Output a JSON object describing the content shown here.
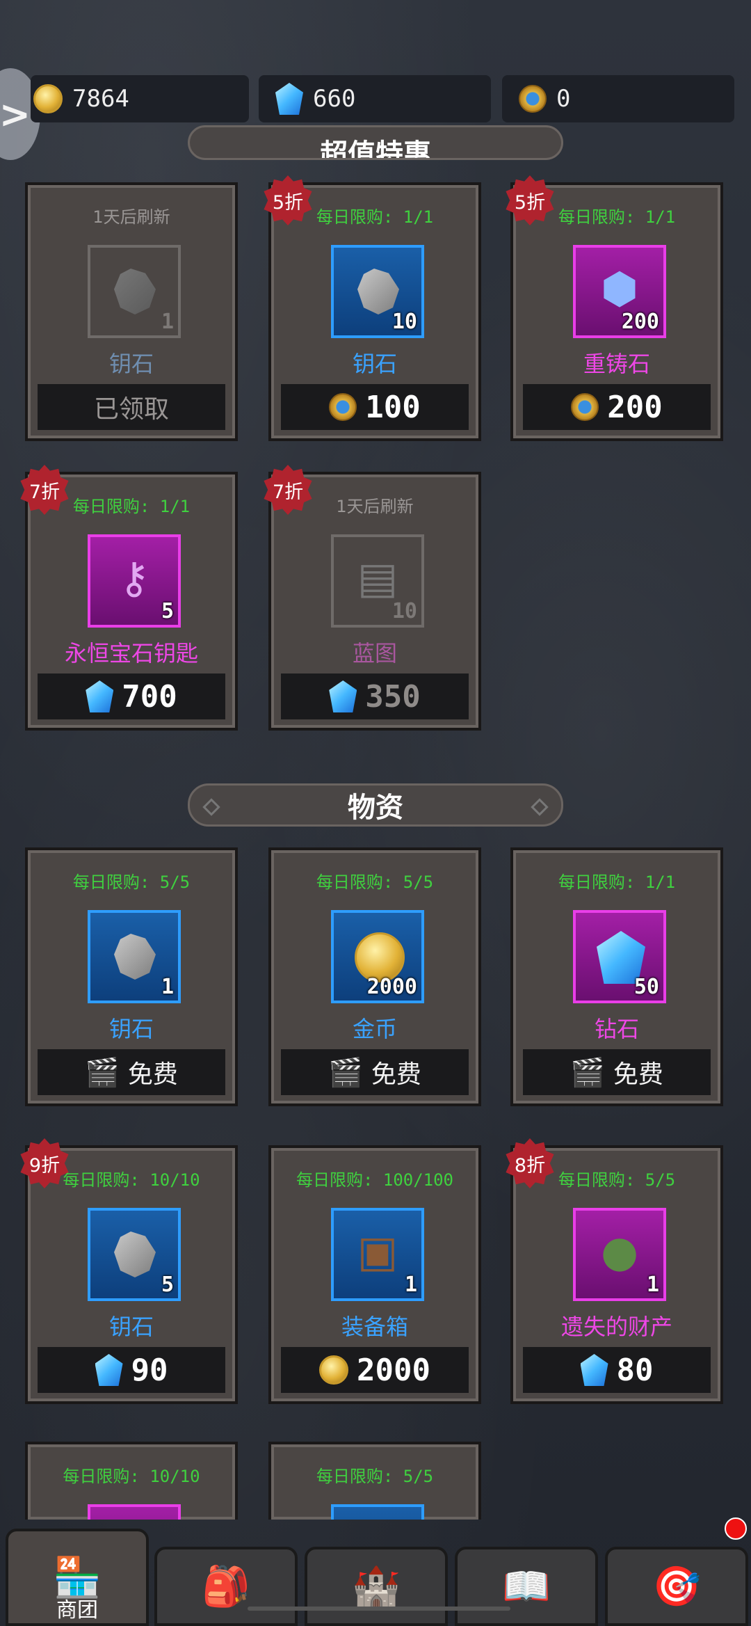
{
  "currencies": {
    "gold": "7864",
    "diamond": "660",
    "token": "0"
  },
  "sections": {
    "deals_title": "超值特惠",
    "supplies_title": "物资"
  },
  "deals": [
    {
      "badge": "",
      "limit": "1天后刷新",
      "qty": "1",
      "name": "钥石",
      "price": "",
      "price_text": "已领取",
      "price_icon": "none",
      "style": "dim"
    },
    {
      "badge": "5折",
      "limit": "每日限购: 1/1",
      "qty": "10",
      "name": "钥石",
      "price": "100",
      "price_text": "",
      "price_icon": "token",
      "style": "blue"
    },
    {
      "badge": "5折",
      "limit": "每日限购: 1/1",
      "qty": "200",
      "name": "重铸石",
      "price": "200",
      "price_text": "",
      "price_icon": "token",
      "style": "purple"
    },
    {
      "badge": "7折",
      "limit": "每日限购: 1/1",
      "qty": "5",
      "name": "永恒宝石钥匙",
      "price": "700",
      "price_text": "",
      "price_icon": "diamond",
      "style": "purple"
    },
    {
      "badge": "7折",
      "limit": "1天后刷新",
      "qty": "10",
      "name": "蓝图",
      "price": "350",
      "price_text": "",
      "price_icon": "diamond",
      "style": "dim"
    }
  ],
  "supplies": [
    {
      "badge": "",
      "limit": "每日限购: 5/5",
      "qty": "1",
      "name": "钥石",
      "price": "",
      "price_text": "免费",
      "price_icon": "clapper",
      "style": "blue"
    },
    {
      "badge": "",
      "limit": "每日限购: 5/5",
      "qty": "2000",
      "name": "金币",
      "price": "",
      "price_text": "免费",
      "price_icon": "clapper",
      "style": "blue"
    },
    {
      "badge": "",
      "limit": "每日限购: 1/1",
      "qty": "50",
      "name": "钻石",
      "price": "",
      "price_text": "免费",
      "price_icon": "clapper",
      "style": "purple"
    },
    {
      "badge": "9折",
      "limit": "每日限购: 10/10",
      "qty": "5",
      "name": "钥石",
      "price": "90",
      "price_text": "",
      "price_icon": "diamond",
      "style": "blue"
    },
    {
      "badge": "",
      "limit": "每日限购: 100/100",
      "qty": "1",
      "name": "装备箱",
      "price": "2000",
      "price_text": "",
      "price_icon": "gold",
      "style": "blue"
    },
    {
      "badge": "8折",
      "limit": "每日限购: 5/5",
      "qty": "1",
      "name": "遗失的财产",
      "price": "80",
      "price_text": "",
      "price_icon": "diamond",
      "style": "purple"
    },
    {
      "badge": "",
      "limit": "每日限购: 10/10",
      "qty": "",
      "name": "",
      "price": "",
      "price_text": "",
      "price_icon": "none",
      "style": "purple"
    },
    {
      "badge": "",
      "limit": "每日限购: 5/5",
      "qty": "",
      "name": "",
      "price": "",
      "price_text": "",
      "price_icon": "none",
      "style": "blue"
    }
  ],
  "nav": {
    "tabs": [
      {
        "label": "商团",
        "icon": "shop-icon"
      },
      {
        "label": "",
        "icon": "backpack-icon"
      },
      {
        "label": "",
        "icon": "castle-icon"
      },
      {
        "label": "",
        "icon": "book-icon"
      },
      {
        "label": "",
        "icon": "target-icon"
      }
    ]
  },
  "colors": {
    "limit_green": "#3fd13f",
    "blue_name": "#3aa2ff",
    "purple_name": "#ee47e6",
    "badge_red": "#b0232e"
  }
}
